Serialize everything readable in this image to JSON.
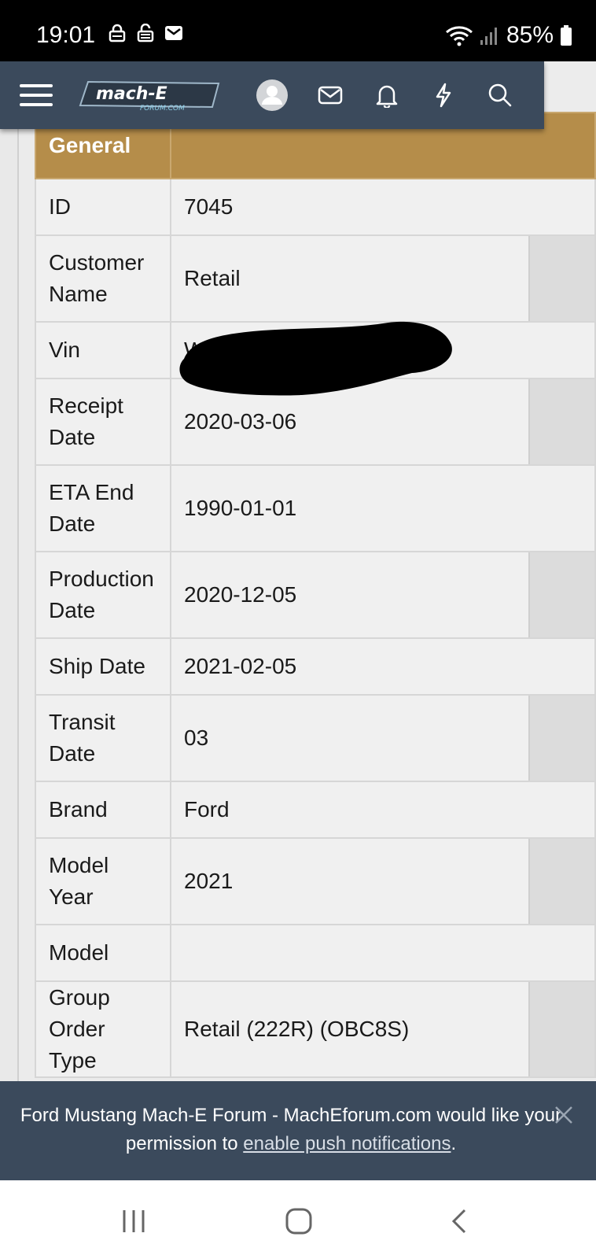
{
  "status_bar": {
    "time": "19:01",
    "battery": "85%",
    "icons": [
      "lock-icon",
      "unlock-icon",
      "mail-icon",
      "wifi-icon",
      "signal-icon",
      "battery-icon"
    ]
  },
  "navbar": {
    "logo_text": "mach-E",
    "logo_sub": "FORUM.COM",
    "icons": [
      "menu-icon",
      "avatar-icon",
      "envelope-icon",
      "bell-icon",
      "bolt-icon",
      "search-icon"
    ]
  },
  "table": {
    "header": "General",
    "rows": [
      {
        "label": "ID",
        "value": "7045"
      },
      {
        "label": "Customer Name",
        "value": "Retail"
      },
      {
        "label": "Vin",
        "value": "WF0"
      },
      {
        "label": "Receipt Date",
        "value": "2020-03-06"
      },
      {
        "label": "ETA End Date",
        "value": "1990-01-01"
      },
      {
        "label": "Production Date",
        "value": "2020-12-05"
      },
      {
        "label": "Ship Date",
        "value": "2021-02-05"
      },
      {
        "label": "Transit Date",
        "value": "03"
      },
      {
        "label": "Brand",
        "value": "Ford"
      },
      {
        "label": "Model Year",
        "value": "2021"
      },
      {
        "label": "Model",
        "value": ""
      },
      {
        "label": "Group Order Type",
        "value": "Retail (222R) (OBC8S)"
      }
    ]
  },
  "push_banner": {
    "text_before": "Ford Mustang Mach-E Forum - MachEforum.com would like your permission to ",
    "link_text": "enable push notifications",
    "text_after": "."
  },
  "colors": {
    "navbar": "#3b4a5c",
    "header_gold": "#b58d4a",
    "cell_bg": "#f0f0f0"
  }
}
